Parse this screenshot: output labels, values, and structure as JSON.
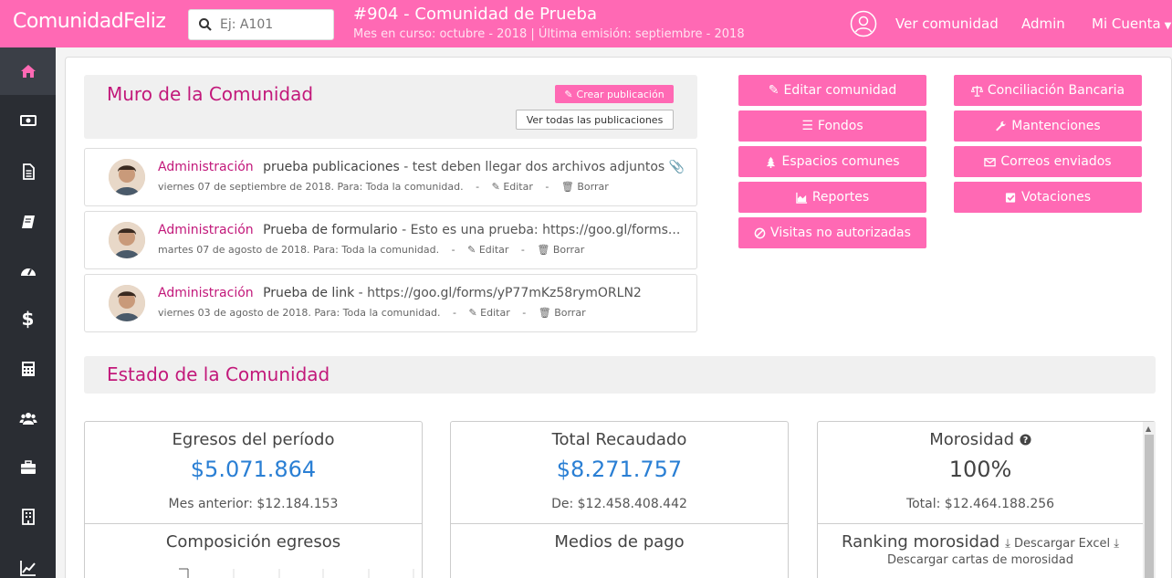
{
  "brand": "ComunidadFeliz",
  "search": {
    "placeholder": "Ej: A101"
  },
  "community": {
    "title": "#904 - Comunidad de Prueba",
    "subtitle": "Mes en curso: octubre - 2018 | Última emisión: septiembre - 2018"
  },
  "nav": {
    "ver_comunidad": "Ver comunidad",
    "admin": "Admin",
    "mi_cuenta": "Mi Cuenta"
  },
  "sidebar": {
    "items": [
      {
        "icon": "home-icon"
      },
      {
        "icon": "money-icon"
      },
      {
        "icon": "document-icon"
      },
      {
        "icon": "book-icon"
      },
      {
        "icon": "dashboard-icon"
      },
      {
        "icon": "dollar-icon"
      },
      {
        "icon": "calculator-icon"
      },
      {
        "icon": "users-icon"
      },
      {
        "icon": "briefcase-icon"
      },
      {
        "icon": "building-icon"
      },
      {
        "icon": "line-chart-icon"
      }
    ]
  },
  "wall": {
    "title": "Muro de la Comunidad",
    "create_label": "Crear publicación",
    "see_all_label": "Ver todas las publicaciones"
  },
  "posts": [
    {
      "author": "Administración",
      "title": "prueba publicaciones",
      "body": "- test deben llegar dos archivos adjuntos",
      "meta": "viernes 07 de septiembre de 2018. Para: Toda la comunidad.",
      "edit": "Editar",
      "delete": "Borrar"
    },
    {
      "author": "Administración",
      "title": "Prueba de formulario",
      "body": "- Esto es una prueba: https://goo.gl/forms...",
      "meta": "martes 07 de agosto de 2018. Para: Toda la comunidad.",
      "edit": "Editar",
      "delete": "Borrar"
    },
    {
      "author": "Administración",
      "title": "Prueba de link",
      "body": "- https://goo.gl/forms/yP77mKz58rymORLN2",
      "meta": "viernes 03 de agosto de 2018. Para: Toda la comunidad.",
      "edit": "Editar",
      "delete": "Borrar"
    }
  ],
  "actions": {
    "editar_comunidad": "Editar comunidad",
    "fondos": "Fondos",
    "espacios_comunes": "Espacios comunes",
    "reportes": "Reportes",
    "visitas_no_autorizadas": "Visitas no autorizadas",
    "conciliacion_bancaria": "Conciliación Bancaria",
    "mantenciones": "Mantenciones",
    "correos_enviados": "Correos enviados",
    "votaciones": "Votaciones"
  },
  "estado": {
    "title": "Estado de la Comunidad"
  },
  "cards": {
    "egresos": {
      "label": "Egresos del período",
      "value": "$5.071.864",
      "sub": "Mes anterior: $12.184.153",
      "label2": "Composición egresos"
    },
    "recaudado": {
      "label": "Total Recaudado",
      "value": "$8.271.757",
      "sub": "De: $12.458.408.442",
      "label2": "Medios de pago"
    },
    "morosidad": {
      "label": "Morosidad",
      "value": "100%",
      "sub": "Total: $12.464.188.256",
      "label2": "Ranking morosidad",
      "download_excel": "Descargar Excel",
      "download_cartas": "Descargar cartas de morosidad"
    }
  },
  "colors": {
    "brand": "#ff69b4",
    "accent_text": "#c2187a",
    "value_blue": "#2a7fd4",
    "sidebar": "#2a2d33"
  }
}
